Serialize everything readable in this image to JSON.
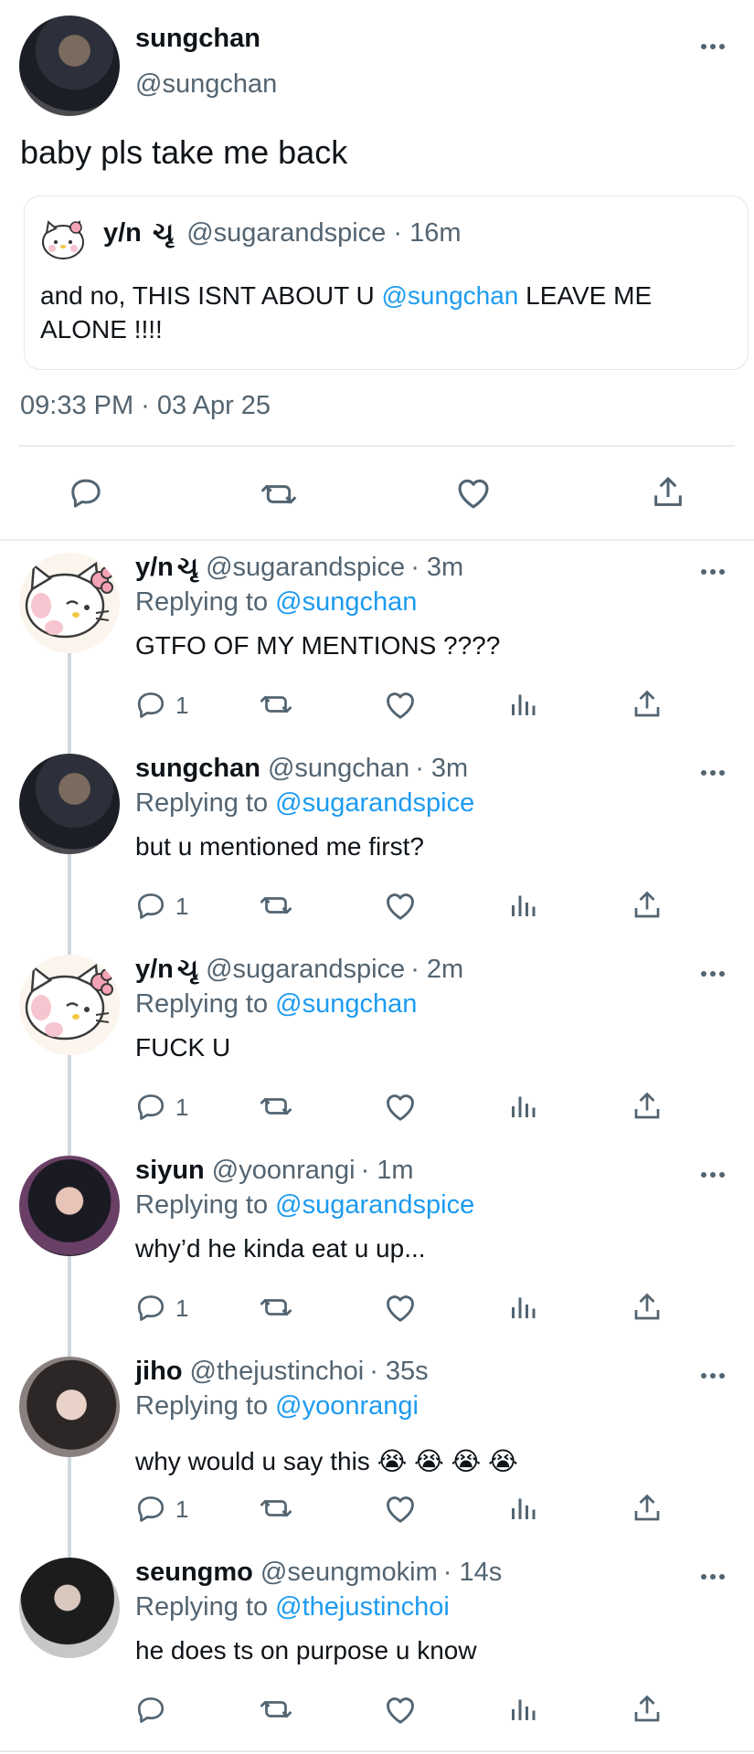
{
  "main_tweet": {
    "name": "sungchan",
    "handle": "@sungchan",
    "text": "baby pls take me back",
    "timestamp": "09:33 PM · 03 Apr 25"
  },
  "quoted_tweet": {
    "name": "y/n",
    "name_emoji": "ચૃ",
    "handle": "@sugarandspice",
    "time": "· 16m",
    "text_before": "and no, THIS ISNT ABOUT U ",
    "mention": "@sungchan",
    "text_after_1": " LEAVE ME",
    "text_after_2": "ALONE !!!!"
  },
  "replies": [
    {
      "name": "y/n",
      "name_emoji": "ચૃ",
      "handle": "@sugarandspice",
      "time": "· 3m",
      "replying_label": "Replying to",
      "replying_to": "@sungchan",
      "text": "GTFO OF MY MENTIONS ????",
      "reply_count": "1",
      "avatar": "hello-kitty"
    },
    {
      "name": "sungchan",
      "name_emoji": "",
      "handle": "@sungchan",
      "time": "· 3m",
      "replying_label": "Replying to",
      "replying_to": "@sugarandspice",
      "text": "but u mentioned me first?",
      "reply_count": "1",
      "avatar": "sungchan"
    },
    {
      "name": "y/n",
      "name_emoji": "ચૃ",
      "handle": "@sugarandspice",
      "time": "· 2m",
      "replying_label": "Replying to",
      "replying_to": "@sungchan",
      "text": "FUCK U",
      "reply_count": "1",
      "avatar": "hello-kitty"
    },
    {
      "name": "siyun",
      "name_emoji": "",
      "handle": "@yoonrangi",
      "time": "· 1m",
      "replying_label": "Replying to",
      "replying_to": "@sugarandspice",
      "text": "why’d he kinda eat u up...",
      "reply_count": "1",
      "avatar": "siyun"
    },
    {
      "name": "jiho",
      "name_emoji": "",
      "handle": "@thejustinchoi",
      "time": "· 35s",
      "replying_label": "Replying to",
      "replying_to": "@yoonrangi",
      "text": "why would u say this 😭 😭 😭 😭",
      "reply_count": "1",
      "avatar": "jiho"
    },
    {
      "name": "seungmo",
      "name_emoji": "",
      "handle": "@seungmokim",
      "time": "· 14s",
      "replying_label": "Replying to",
      "replying_to": "@thejustinchoi",
      "text": "he does ts on purpose u know",
      "reply_count": "",
      "avatar": "seungmo"
    }
  ],
  "colors": {
    "link": "#1d9bf0",
    "secondary_text": "#536471",
    "primary_text": "#0f1419",
    "divider": "#e9ecee"
  },
  "icons": [
    "more-icon",
    "reply-icon",
    "retweet-icon",
    "like-icon",
    "share-icon",
    "views-icon"
  ]
}
